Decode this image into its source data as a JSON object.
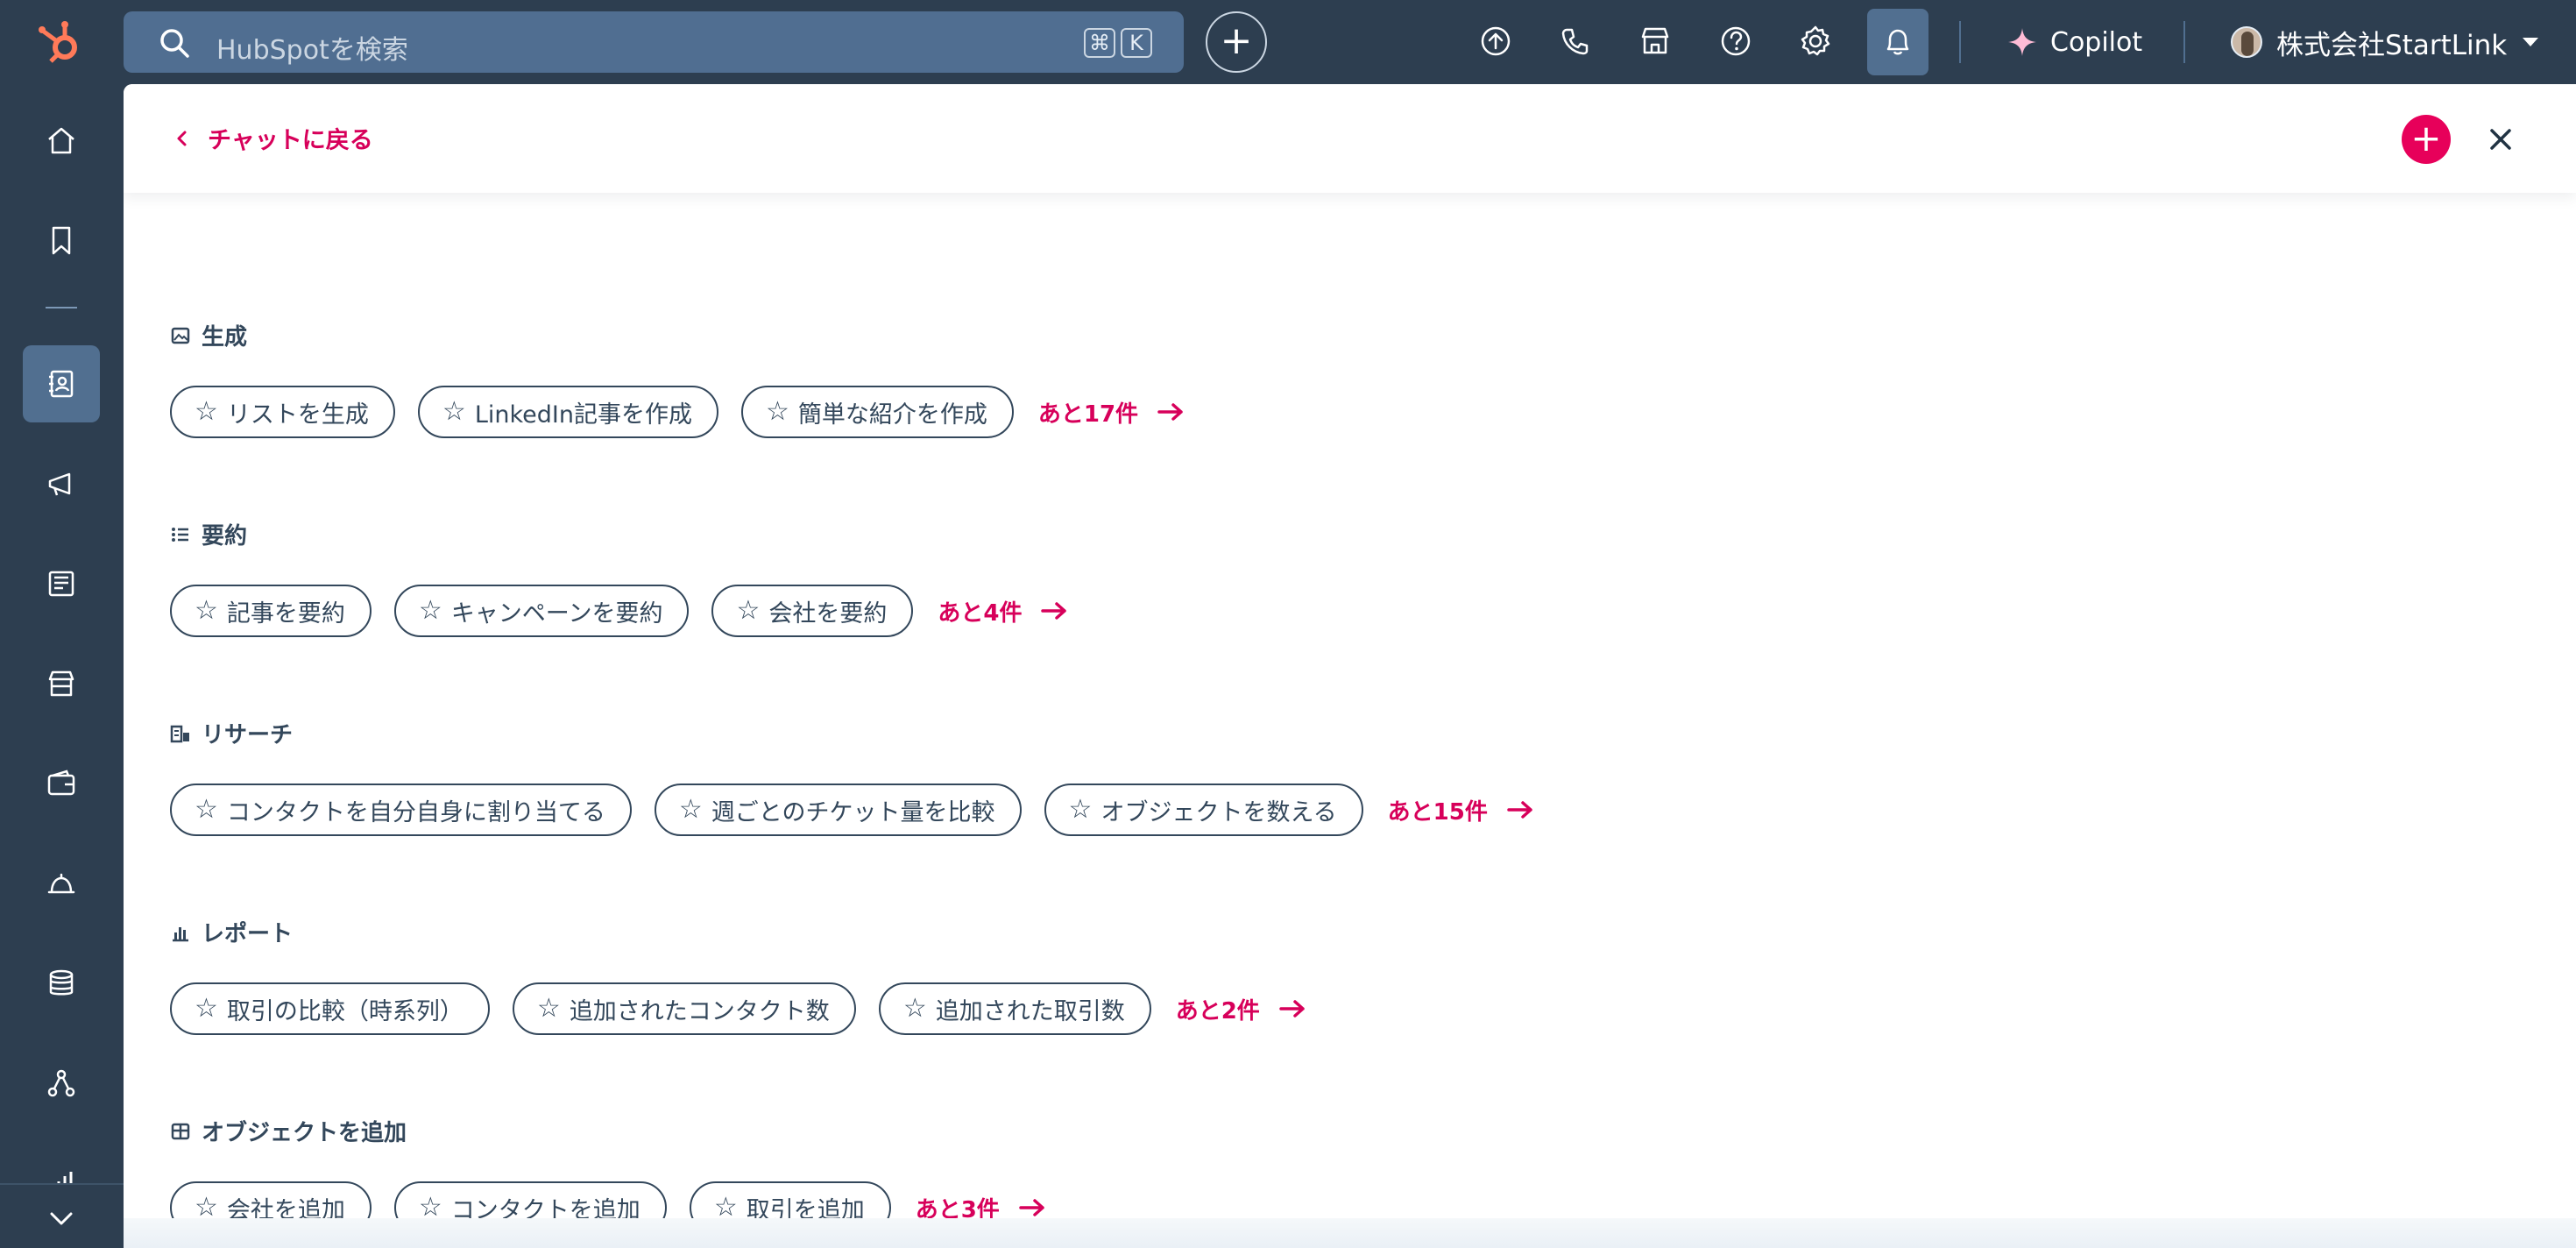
{
  "topbar": {
    "logo_icon": "hubspot-logo-icon",
    "search_placeholder": "HubSpotを検索",
    "shortcut_cmd": "⌘",
    "shortcut_key": "K",
    "add_label": "+",
    "icons": [
      "upgrade-icon",
      "phone-icon",
      "marketplace-icon",
      "help-icon",
      "settings-icon",
      "notifications-icon"
    ],
    "copilot_label": "Copilot",
    "account_name": "株式会社StartLink"
  },
  "sidebar": {
    "items": [
      "home-icon",
      "bookmark-icon",
      "contacts-icon",
      "marketing-icon",
      "content-icon",
      "commerce-icon",
      "sales-icon",
      "service-icon",
      "data-icon",
      "automation-icon",
      "reporting-icon"
    ],
    "active_index": 2,
    "expand_icon": "chevron-down-icon"
  },
  "panel": {
    "back_label": "チャットに戻る",
    "add_label": "+",
    "close_icon": "close-icon"
  },
  "sections": [
    {
      "title": "生成",
      "icon": "image-icon",
      "chips": [
        "リストを生成",
        "LinkedIn記事を作成",
        "簡単な紹介を作成"
      ],
      "more": "あと17件"
    },
    {
      "title": "要約",
      "icon": "list-icon",
      "chips": [
        "記事を要約",
        "キャンペーンを要約",
        "会社を要約"
      ],
      "more": "あと4件"
    },
    {
      "title": "リサーチ",
      "icon": "research-icon",
      "chips": [
        "コンタクトを自分自身に割り当てる",
        "週ごとのチケット量を比較",
        "オブジェクトを数える"
      ],
      "more": "あと15件"
    },
    {
      "title": "レポート",
      "icon": "bar-chart-icon",
      "chips": [
        "取引の比較（時系列）",
        "追加されたコンタクト数",
        "追加された取引数"
      ],
      "more": "あと2件"
    },
    {
      "title": "オブジェクトを追加",
      "icon": "table-icon",
      "chips": [
        "会社を追加",
        "コンタクトを追加",
        "取引を追加"
      ],
      "more": "あと3件"
    }
  ],
  "colors": {
    "nav_bg": "#2d3e50",
    "search_bg": "#506e91",
    "accent": "#d7005a",
    "text": "#33475b"
  }
}
